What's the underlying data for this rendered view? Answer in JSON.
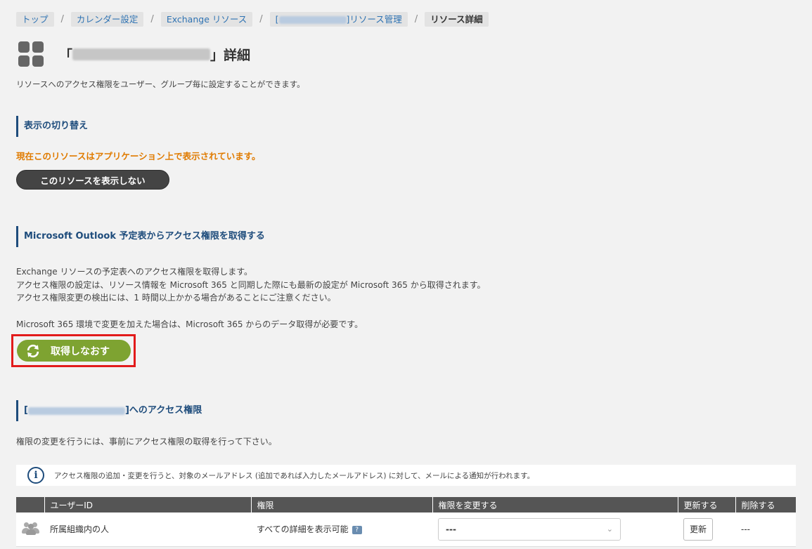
{
  "breadcrumb": {
    "items": [
      "トップ",
      "カレンダー設定",
      "Exchange リソース"
    ],
    "manage_prefix": "[",
    "manage_suffix": "]リソース管理",
    "current": "リソース詳細",
    "separator": "/"
  },
  "title": {
    "open_bracket": "「",
    "close_bracket": "」詳細",
    "icon": "grid-icon"
  },
  "description": "リソースへのアクセス権限をユーザー、グループ毎に設定することができます。",
  "display_section": {
    "heading": "表示の切り替え",
    "status": "現在このリソースはアプリケーション上で表示されています。",
    "hide_button": "このリソースを表示しない",
    "status_color": "#e07b00"
  },
  "outlook_section": {
    "heading": "Microsoft Outlook 予定表からアクセス権限を取得する",
    "lines": [
      "Exchange リソースの予定表へのアクセス権限を取得します。",
      "アクセス権限の設定は、リソース情報を Microsoft 365 と同期した際にも最新の設定が Microsoft 365 から取得されます。",
      "アクセス権限変更の検出には、1 時間以上かかる場合があることにご注意ください。"
    ],
    "note": "Microsoft 365 環境で変更を加えた場合は、Microsoft 365 からのデータ取得が必要です。",
    "refetch_button": "取得しなおす",
    "button_color": "#7ea331"
  },
  "access_section": {
    "heading_prefix": "[",
    "heading_suffix": "]へのアクセス権限",
    "note": "権限の変更を行うには、事前にアクセス権限の取得を行って下さい。",
    "info": "アクセス権限の追加・変更を行うと、対象のメールアドレス (追加であれば入力したメールアドレス) に対して、メールによる通知が行われます。"
  },
  "table": {
    "headers": [
      "",
      "ユーザーID",
      "権限",
      "権限を変更する",
      "更新する",
      "削除する"
    ],
    "rows": [
      {
        "user": "所属組織内の人",
        "permission": "すべての詳細を表示可能",
        "help": "?",
        "select_value": "---",
        "update_button": "更新",
        "delete": "---"
      }
    ]
  },
  "colors": {
    "accent": "#1e4c7c",
    "link": "#2f73b3",
    "highlight_border": "#e21b1b",
    "table_header": "#555555"
  }
}
